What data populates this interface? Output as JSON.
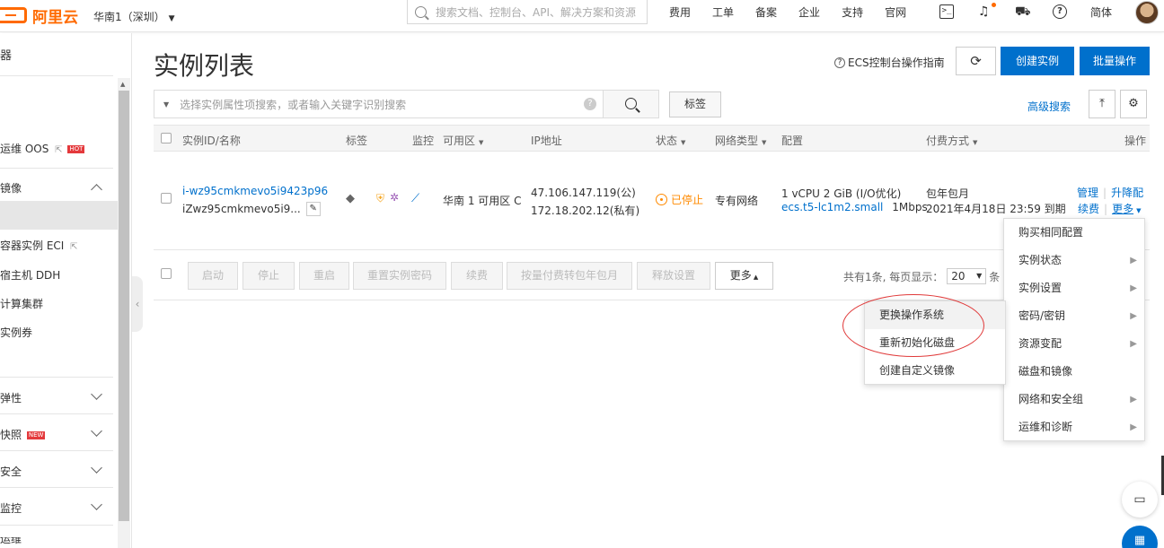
{
  "topbar": {
    "logo_text": "阿里云",
    "region": "华南1（深圳）",
    "search_placeholder": "搜索文档、控制台、API、解决方案和资源",
    "nav": [
      "费用",
      "工单",
      "备案",
      "企业",
      "支持",
      "官网"
    ],
    "icons": [
      "terminal-icon",
      "bell-icon",
      "cart-icon",
      "help-icon"
    ],
    "lang": "简体",
    "accent": "#ff6a00"
  },
  "sidebar": {
    "header": "器",
    "items": {
      "oos": "运维 OOS",
      "oos_badge": "HOT",
      "images": "镜像",
      "eci": "容器实例 ECI",
      "ddh": "宿主机 DDH",
      "cluster": "计算集群",
      "coupon": "实例券",
      "elastic": "弹性",
      "snapshot": "快照",
      "snapshot_badge": "NEW",
      "security": "安全",
      "monitor": "监控",
      "more": "运维"
    }
  },
  "main": {
    "title": "实例列表",
    "guide": "ECS控制台操作指南",
    "create_btn": "创建实例",
    "batch_btn": "批量操作",
    "filter_placeholder": "选择实例属性项搜索，或者输入关键字识别搜索",
    "tag_btn": "标签",
    "advanced_search": "高级搜索"
  },
  "table": {
    "headers": {
      "id": "实例ID/名称",
      "tag": "标签",
      "monitor": "监控",
      "zone": "可用区",
      "ip": "IP地址",
      "status": "状态",
      "network": "网络类型",
      "config": "配置",
      "billing": "付费方式",
      "ops": "操作"
    },
    "row": {
      "id": "i-wz95cmkmevo5i9423p96",
      "name": "iZwz95cmkmevo5i9...",
      "zone": "华南 1 可用区 C",
      "ip_public": "47.106.147.119(公)",
      "ip_private": "172.18.202.12(私有)",
      "status": "已停止",
      "network": "专有网络",
      "config_spec": "1 vCPU 2 GiB (I/O优化)",
      "config_type": "ecs.t5-lc1m2.small",
      "bandwidth": "1Mbps",
      "billing_type": "包年包月",
      "expire": "2021年4月18日 23:59 到期",
      "op_manage": "管理",
      "op_upgrade": "升降配",
      "op_renew": "续费",
      "op_more": "更多"
    },
    "status_color": "#ff8a00"
  },
  "footer": {
    "buttons": [
      "启动",
      "停止",
      "重启",
      "重置实例密码",
      "续费",
      "按量付费转包年包月",
      "释放设置"
    ],
    "more_btn": "更多",
    "total": "共有1条, 每页显示：",
    "page_size": "20",
    "unit": "条"
  },
  "more_menu": [
    {
      "label": "购买相同配置",
      "sub": false
    },
    {
      "label": "实例状态",
      "sub": true
    },
    {
      "label": "实例设置",
      "sub": true
    },
    {
      "label": "密码/密钥",
      "sub": true
    },
    {
      "label": "资源变配",
      "sub": true
    },
    {
      "label": "磁盘和镜像",
      "sub": false
    },
    {
      "label": "网络和安全组",
      "sub": true
    },
    {
      "label": "运维和诊断",
      "sub": true
    }
  ],
  "disk_submenu": [
    "更换操作系统",
    "重新初始化磁盘",
    "创建自定义镜像"
  ]
}
